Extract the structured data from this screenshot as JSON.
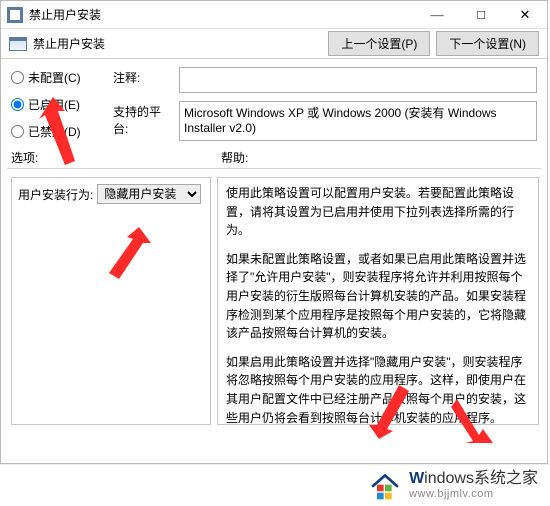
{
  "window": {
    "title": "禁止用户安装",
    "minimize_glyph": "—",
    "maximize_glyph": "□",
    "close_glyph": "✕"
  },
  "subheader": {
    "title": "禁止用户安装",
    "prev_label": "上一个设置(P)",
    "next_label": "下一个设置(N)"
  },
  "radios": {
    "not_configured": "未配置(C)",
    "enabled": "已启用(E)",
    "disabled": "已禁用(D)",
    "selected": "enabled"
  },
  "fields": {
    "comment_label": "注释:",
    "comment_value": "",
    "platform_label": "支持的平台:",
    "platform_value": "Microsoft Windows XP 或 Windows 2000 (安装有 Windows Installer v2.0)"
  },
  "sections": {
    "options_label": "选项:",
    "help_label": "帮助:"
  },
  "options": {
    "behavior_label": "用户安装行为:",
    "behavior_selected": "隐藏用户安装"
  },
  "help": {
    "p1": "使用此策略设置可以配置用户安装。若要配置此策略设置，请将其设置为已启用并使用下拉列表选择所需的行为。",
    "p2": "如果未配置此策略设置，或者如果已启用此策略设置并选择了\"允许用户安装\"，则安装程序将允许并利用按照每个用户安装的衍生版照每台计算机安装的产品。如果安装程序检测到某个应用程序是按照每个用户安装的，它将隐藏该产品按照每台计算机的安装。",
    "p3": "如果启用此策略设置并选择\"隐藏用户安装\"，则安装程序将忽略按照每个用户安装的应用程序。这样，即使用户在其用户配置文件中已经注册产品按照每个用户的安装，这些用户仍将会看到按照每台计算机安装的应用程序。"
  },
  "watermark": {
    "brand_colored": "W",
    "brand_rest": "indows",
    "brand_tail": "系统之家",
    "url": "www.bjjmlv.com"
  }
}
